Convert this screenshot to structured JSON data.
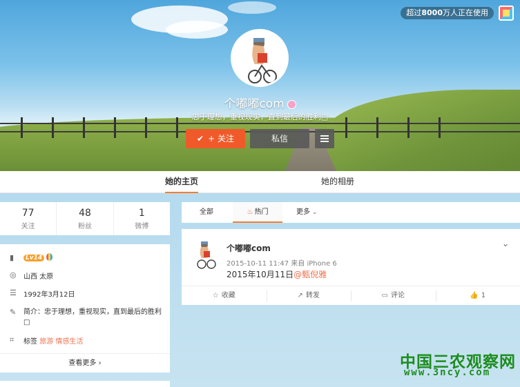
{
  "header": {
    "usage_badge_prefix": "超过",
    "usage_badge_count": "8000",
    "usage_badge_suffix": "万人正在使用",
    "nickname": "个嘟嘟com",
    "motto": "忠于理想，重视现实，直到最后的胜利□",
    "follow_label": "关注",
    "message_label": "私信"
  },
  "profile_tabs": [
    "她的主页",
    "她的相册"
  ],
  "stats": [
    {
      "num": "77",
      "label": "关注"
    },
    {
      "num": "48",
      "label": "粉丝"
    },
    {
      "num": "1",
      "label": "微博"
    }
  ],
  "info": {
    "level": "Lv14",
    "location": "山西 太原",
    "birthday": "1992年3月12日",
    "bio": "简介：忠于理想，重视现实，直到最后的胜利□",
    "tags_label": "标签",
    "tags": "旅游 情感生活",
    "more": "查看更多"
  },
  "feed_tabs": {
    "all": "全部",
    "hot": "热门",
    "more": "更多"
  },
  "post": {
    "author": "个嘟嘟com",
    "meta": "2015-10-11 11:47 来自 iPhone 6",
    "text": "2015年10月11日",
    "mention": "@甄倪雅",
    "actions": {
      "collect": "收藏",
      "repost": "转发",
      "comment": "评论",
      "like": "1"
    }
  },
  "watermark": {
    "cn": "中国三农观察网",
    "url": "www.3ncy.com"
  },
  "colors": {
    "accent": "#f05a2a",
    "tab_underline": "#f77c2e",
    "link": "#eb7350",
    "watermark": "#1d8c1d"
  }
}
